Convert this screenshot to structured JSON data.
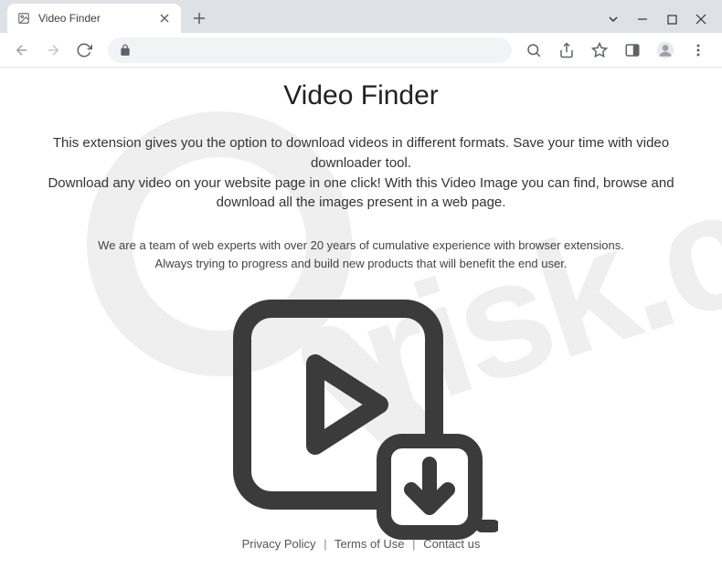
{
  "window": {
    "tab_title": "Video Finder"
  },
  "page": {
    "title": "Video Finder",
    "desc1": "This extension gives you the option to download videos in different formats. Save your time with video downloader tool.",
    "desc2": "Download any video on your website page in one click! With this Video Image you can find, browse and download all the images present in a web page.",
    "team1": "We are a team of web experts with over 20 years of cumulative experience with browser extensions.",
    "team2": "Always trying to progress and build new products that will benefit the end user."
  },
  "footer": {
    "privacy": "Privacy Policy",
    "terms": "Terms of Use",
    "contact": "Contact us"
  }
}
